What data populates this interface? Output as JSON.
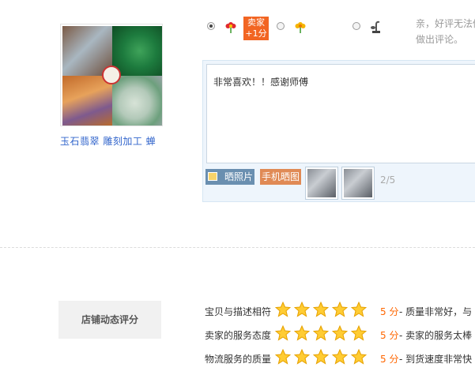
{
  "product": {
    "title": "玉石翡翠 雕刻加工 蝉"
  },
  "rating": {
    "seller_badge": "卖家 +1分",
    "hint_line1": "亲，好评无法修",
    "hint_line2": "做出评论。",
    "options": [
      {
        "name": "good",
        "icon": "red-flower-icon",
        "checked": true
      },
      {
        "name": "neutral",
        "icon": "yellow-flower-icon",
        "checked": false
      },
      {
        "name": "bad",
        "icon": "dead-plant-icon",
        "checked": false
      }
    ]
  },
  "comment": {
    "text": "非常喜欢！！感谢师傅",
    "photo_button": "晒照片",
    "phone_button": "手机晒图",
    "uploaded_count": "2/5"
  },
  "shop_rating": {
    "title": "店铺动态评分",
    "rows": [
      {
        "label": "宝贝与描述相符",
        "score": "5 分",
        "stars": 5,
        "desc": "- 质量非常好，与"
      },
      {
        "label": "卖家的服务态度",
        "score": "5 分",
        "stars": 5,
        "desc": "- 卖家的服务太棒"
      },
      {
        "label": "物流服务的质量",
        "score": "5 分",
        "stars": 5,
        "desc": "- 到货速度非常快"
      }
    ]
  },
  "colors": {
    "link": "#3366cc",
    "accent": "#ff6600",
    "badge": "#f26522"
  }
}
